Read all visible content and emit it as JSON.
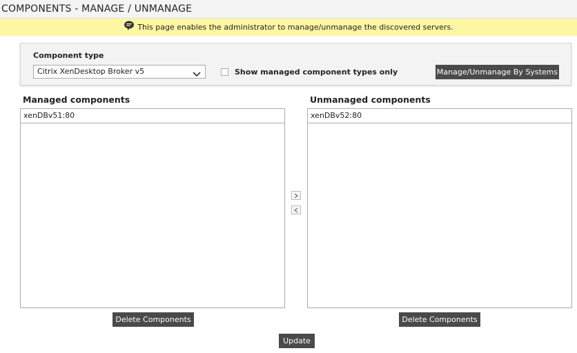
{
  "page": {
    "title": "COMPONENTS - MANAGE / UNMANAGE",
    "info_text": "This page enables the administrator to manage/unmanage the discovered servers."
  },
  "filter": {
    "component_type_label": "Component type",
    "component_type_value": "Citrix XenDesktop Broker v5",
    "show_managed_label": "Show managed component types only",
    "show_managed_checked": false,
    "manage_by_systems_label": "Manage/Unmanage By Systems"
  },
  "managed": {
    "header": "Managed components",
    "items": [
      "xenDBv51:80"
    ],
    "delete_label": "Delete Components"
  },
  "unmanaged": {
    "header": "Unmanaged components",
    "items": [
      "xenDBv52:80"
    ],
    "delete_label": "Delete Components"
  },
  "actions": {
    "update_label": "Update"
  },
  "icons": {
    "info": "speech-bubble-icon",
    "select": "chevron-down-icon",
    "move_right": "chevron-right-icon",
    "move_left": "chevron-left-icon"
  },
  "colors": {
    "info_bar": "#fdf7a3",
    "button": "#4a4a4a",
    "panel": "#f3f3f3"
  }
}
